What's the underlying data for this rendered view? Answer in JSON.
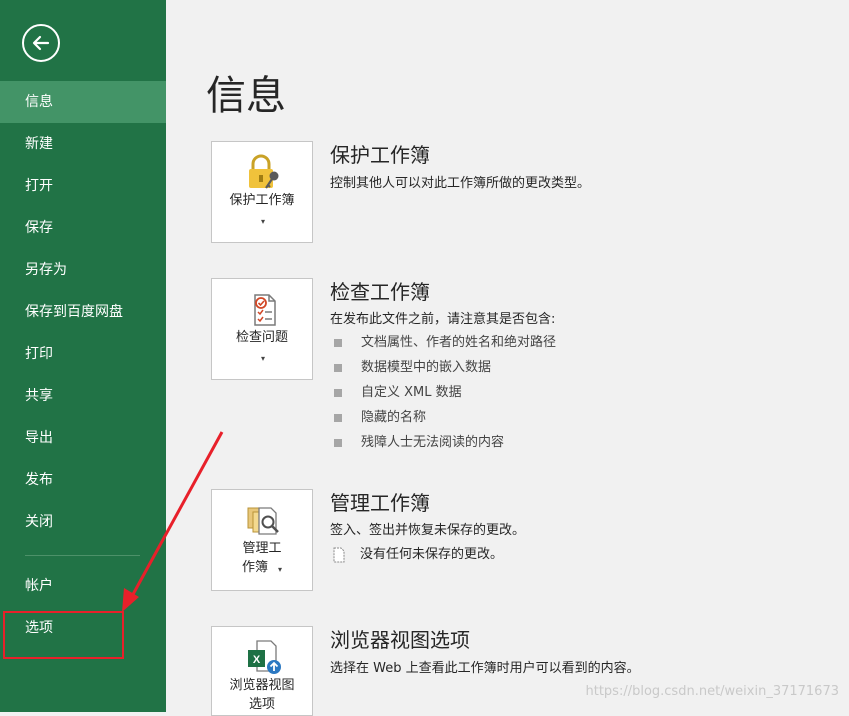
{
  "sidebar": {
    "back_label": "",
    "items": [
      {
        "label": "信息"
      },
      {
        "label": "新建"
      },
      {
        "label": "打开"
      },
      {
        "label": "保存"
      },
      {
        "label": "另存为"
      },
      {
        "label": "保存到百度网盘"
      },
      {
        "label": "打印"
      },
      {
        "label": "共享"
      },
      {
        "label": "导出"
      },
      {
        "label": "发布"
      },
      {
        "label": "关闭"
      },
      {
        "label": "帐户"
      },
      {
        "label": "选项"
      }
    ],
    "active_item": "信息",
    "highlighted_item": "选项"
  },
  "main": {
    "title": "信息",
    "sections": [
      {
        "tile_label": "保护工作簿",
        "title": "保护工作簿",
        "description": "控制其他人可以对此工作簿所做的更改类型。"
      },
      {
        "tile_label": "检查问题",
        "title": "检查工作簿",
        "description": "在发布此文件之前，请注意其是否包含:",
        "bullets": [
          "文档属性、作者的姓名和绝对路径",
          "数据模型中的嵌入数据",
          "自定义 XML 数据",
          "隐藏的名称",
          "残障人士无法阅读的内容"
        ]
      },
      {
        "tile_label_line1": "管理工",
        "tile_label_line2": "作簿",
        "title": "管理工作簿",
        "description": "签入、签出并恢复未保存的更改。",
        "note": "没有任何未保存的更改。"
      },
      {
        "tile_label_line1": "浏览器视图",
        "tile_label_line2": "选项",
        "title": "浏览器视图选项",
        "description": "选择在 Web 上查看此工作簿时用户可以看到的内容。"
      }
    ]
  },
  "watermark": "https://blog.csdn.net/weixin_37171673",
  "colors": {
    "sidebar": "#217346",
    "sidebar_active": "#439467",
    "annotation": "#e8202a"
  },
  "icons": [
    "back-arrow-icon",
    "lock-key-icon",
    "inspect-document-icon",
    "manage-workbook-icon",
    "excel-browser-icon",
    "unsaved-doc-icon"
  ]
}
